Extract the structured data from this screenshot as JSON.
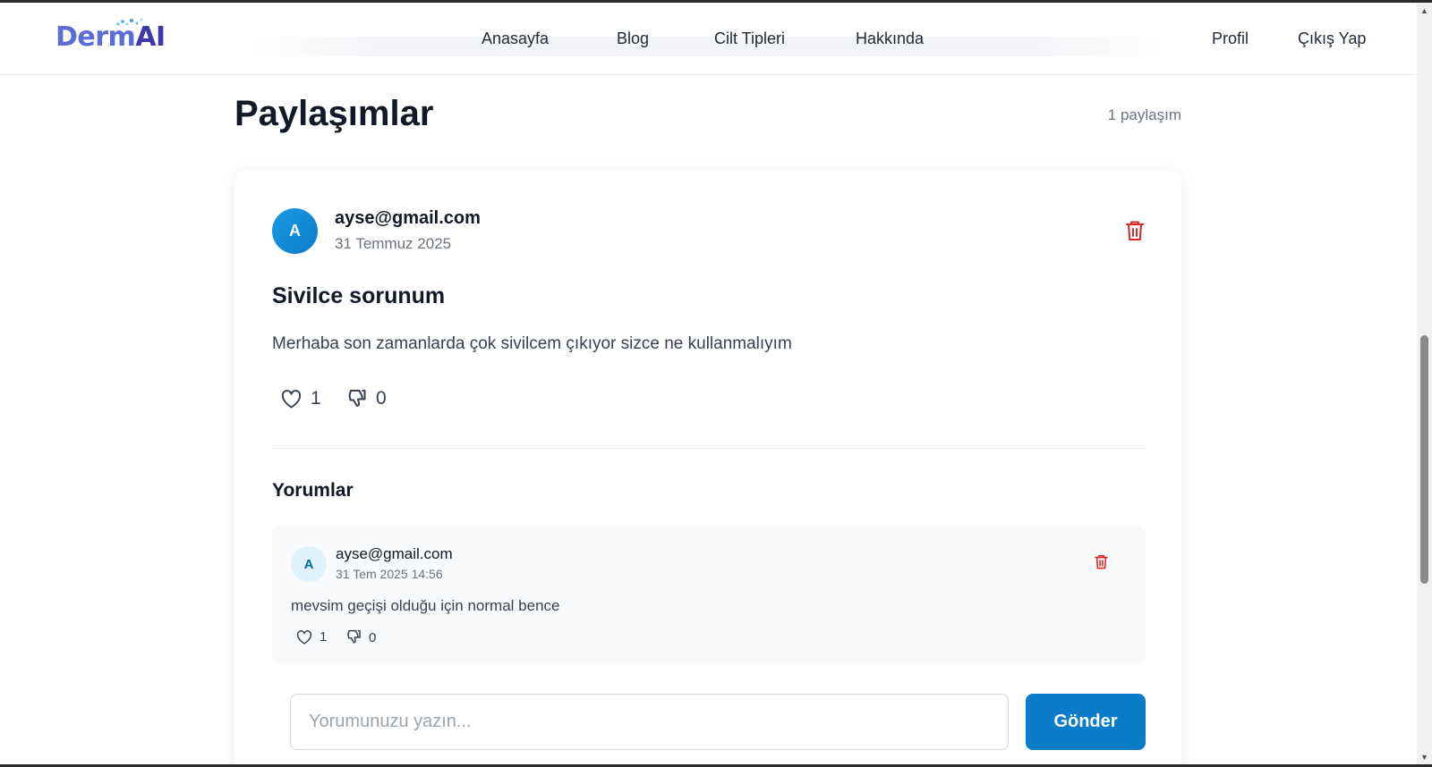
{
  "navbar": {
    "logo": {
      "part1": "Derm",
      "part2": "AI"
    },
    "links": [
      "Anasayfa",
      "Blog",
      "Cilt Tipleri",
      "Hakkında"
    ],
    "profile": "Profil",
    "logout": "Çıkış Yap"
  },
  "header": {
    "title": "Paylaşımlar",
    "count": "1 paylaşım"
  },
  "post": {
    "avatar_initial": "A",
    "author": "ayse@gmail.com",
    "date": "31 Temmuz 2025",
    "title": "Sivilce sorunum",
    "body": "Merhaba son zamanlarda çok sivilcem çıkıyor sizce ne kullanmalıyım",
    "likes": "1",
    "dislikes": "0"
  },
  "comments": {
    "title": "Yorumlar",
    "items": [
      {
        "avatar_initial": "A",
        "author": "ayse@gmail.com",
        "date": "31 Tem 2025 14:56",
        "text": "mevsim geçişi olduğu için normal bence",
        "likes": "1",
        "dislikes": "0"
      }
    ],
    "input_placeholder": "Yorumunuzu yazın...",
    "input_value": "",
    "send_label": "Gönder"
  },
  "colors": {
    "primary": "#0b7cc7",
    "danger": "#dc2626",
    "text": "#111827",
    "muted": "#6b7280"
  },
  "icons": [
    "heart-icon",
    "thumbs-down-icon",
    "trash-icon"
  ]
}
